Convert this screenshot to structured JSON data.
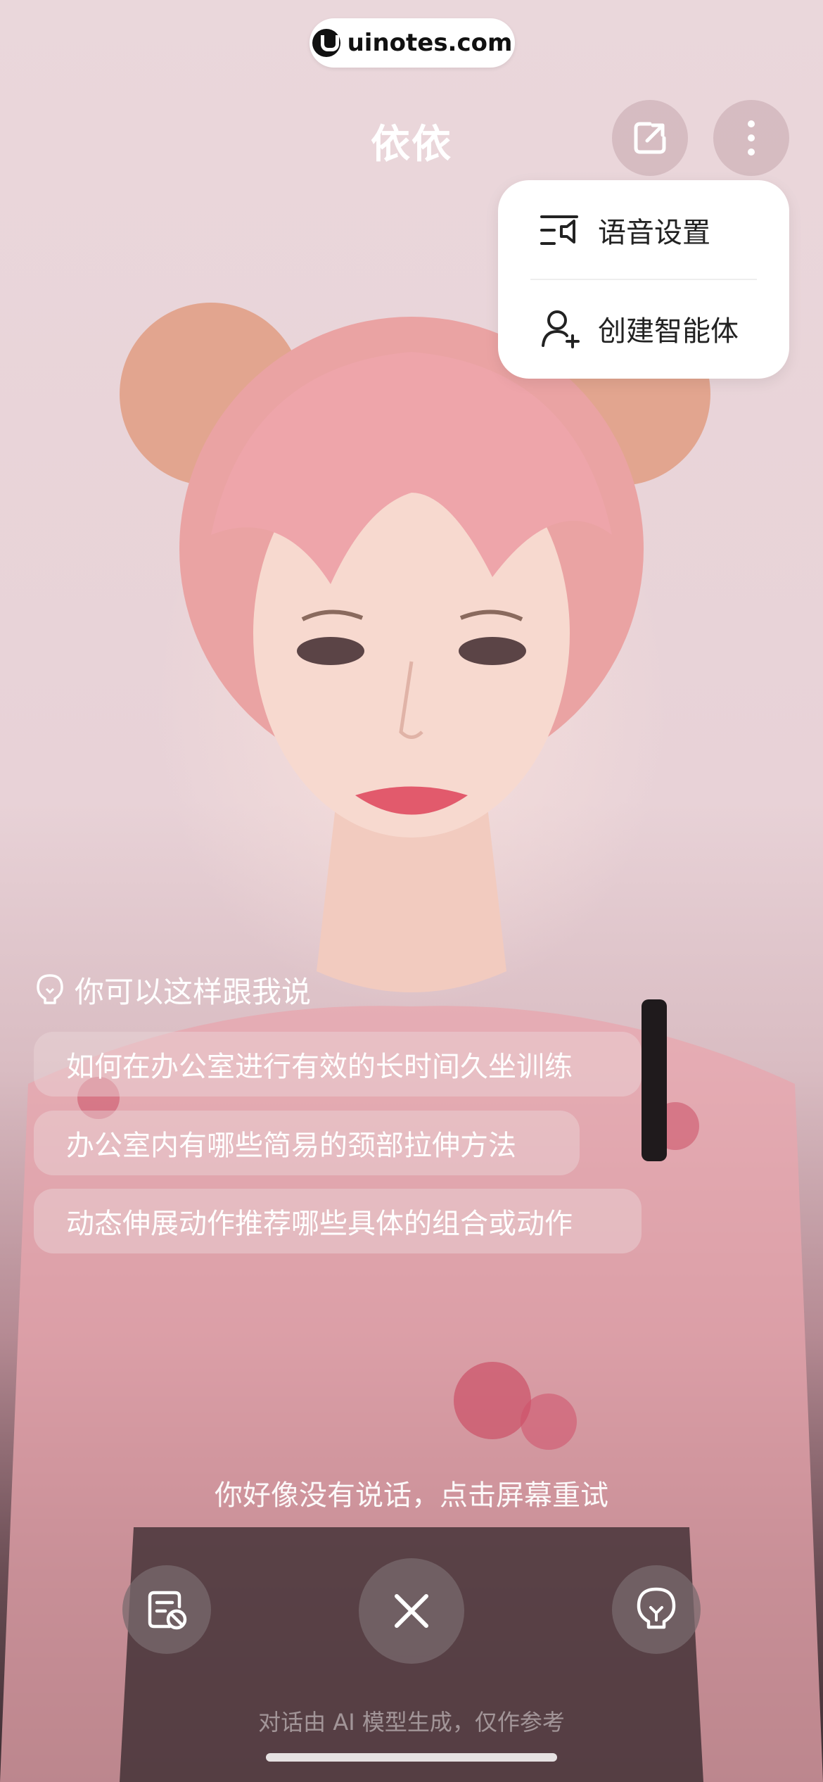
{
  "watermark": {
    "text": "uinotes.com"
  },
  "header": {
    "title": "依依"
  },
  "menu": {
    "items": [
      {
        "label": "语音设置",
        "icon": "voice-settings-icon"
      },
      {
        "label": "创建智能体",
        "icon": "create-agent-icon"
      }
    ]
  },
  "suggestions": {
    "title": "你可以这样跟我说",
    "items": [
      "如何在办公室进行有效的长时间久坐训练",
      "办公室内有哪些简易的颈部拉伸方法",
      "动态伸展动作推荐哪些具体的组合或动作"
    ]
  },
  "status": {
    "message": "你好像没有说话，点击屏幕重试"
  },
  "controls": {
    "left_icon": "subtitle-off-icon",
    "center_icon": "close-icon",
    "right_icon": "lightbulb-icon"
  },
  "footer": {
    "note": "对话由 AI 模型生成，仅作参考"
  },
  "colors": {
    "accent": "#ffffff",
    "menu_bg": "#ffffff",
    "chip_bg": "rgba(235,215,218,0.45)"
  }
}
